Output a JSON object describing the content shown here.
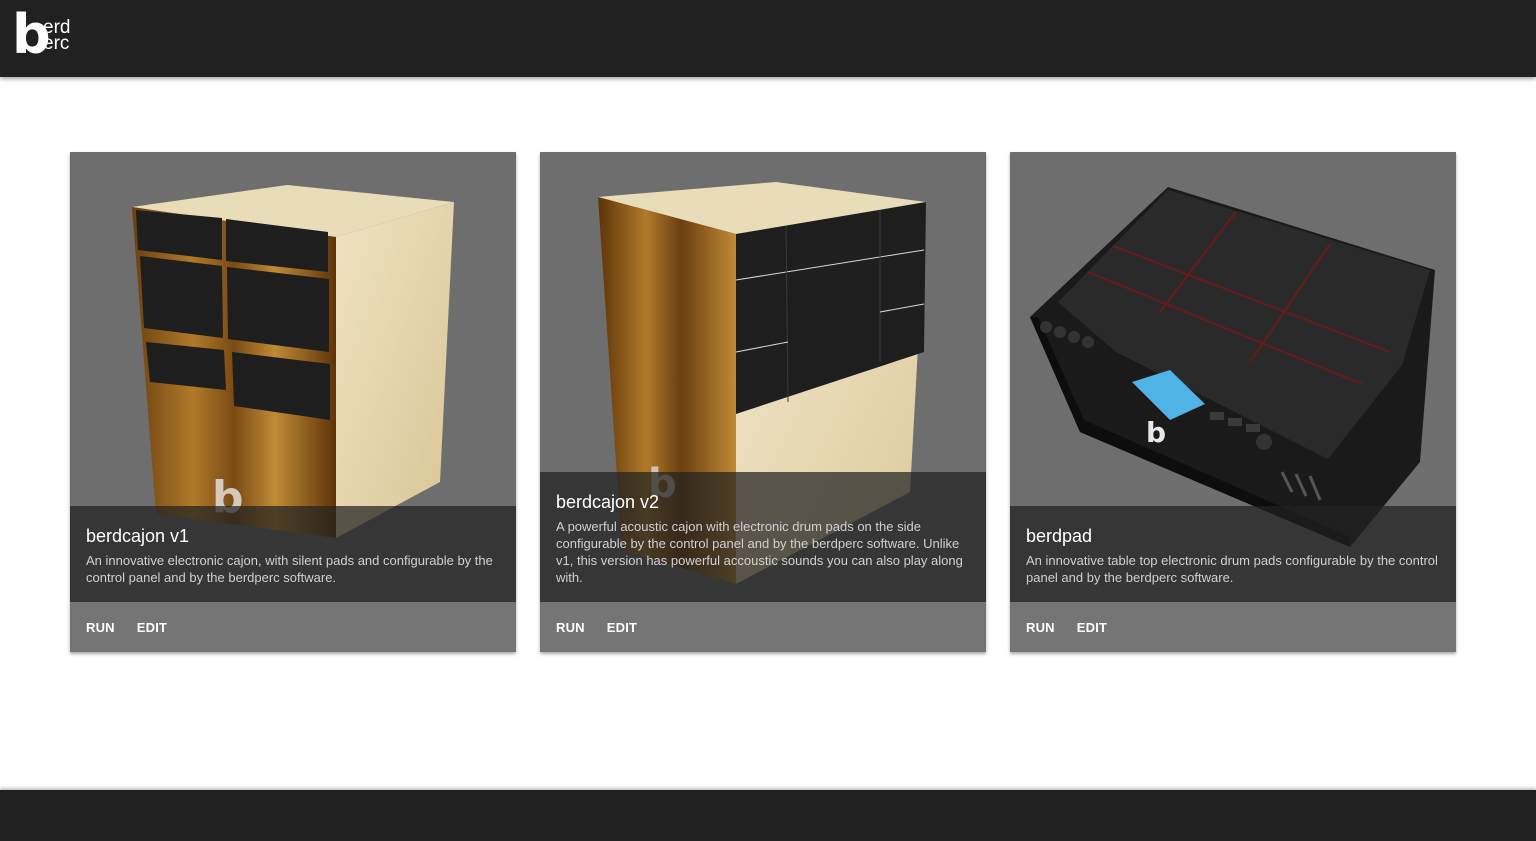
{
  "brand": {
    "logo_letter": "b",
    "logo_line1": "erd",
    "logo_line2": "erc"
  },
  "cards": [
    {
      "title": "berdcajon v1",
      "description": "An innovative electronic cajon, with silent pads and configurable by the control panel and by the berdperc software.",
      "actions": [
        "RUN",
        "EDIT"
      ]
    },
    {
      "title": "berdcajon v2",
      "description": "A powerful acoustic cajon with electronic drum pads on the side configurable by the control panel and by the berdperc software. Unlike v1, this version has powerful accoustic sounds you can also play along with.",
      "actions": [
        "RUN",
        "EDIT"
      ]
    },
    {
      "title": "berdpad",
      "description": "An innovative table top electronic drum pads configurable by the control panel and by the berdperc software.",
      "actions": [
        "RUN",
        "EDIT"
      ]
    }
  ],
  "colors": {
    "topbar": "#212121",
    "card": "#757575",
    "overlay": "rgba(33,33,33,0.72)",
    "wood": "#8a5a1a",
    "birch": "#e8d9b0",
    "screen": "#4fb3e8"
  }
}
